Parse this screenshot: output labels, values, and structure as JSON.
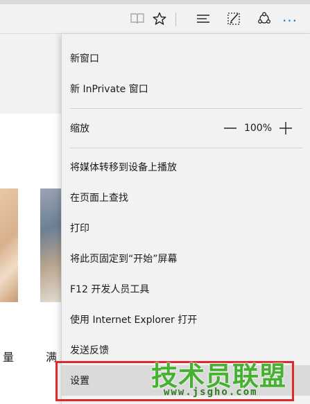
{
  "toolbar": {
    "icons": [
      "reading-view-icon",
      "favorite-star-icon",
      "hub-icon",
      "web-note-icon",
      "share-icon"
    ],
    "more_label": "···"
  },
  "colors": {
    "accent": "#1e78d2",
    "highlight_border": "#e2262c",
    "watermark": "#46b030"
  },
  "page": {
    "text_left": "量",
    "text_mid": "满"
  },
  "menu": {
    "new_window": "新窗口",
    "new_inprivate": "新 InPrivate 窗口",
    "zoom_label": "缩放",
    "zoom_minus": "—",
    "zoom_value": "100%",
    "zoom_plus": "+",
    "cast": "将媒体转移到设备上播放",
    "find": "在页面上查找",
    "print": "打印",
    "pin": "将此页固定到“开始”屏幕",
    "devtools": "F12 开发人员工具",
    "open_ie": "使用 Internet Explorer 打开",
    "feedback": "发送反馈",
    "settings": "设置"
  },
  "watermark": {
    "title": "技术员联盟",
    "url": "www.jsgho.com"
  }
}
